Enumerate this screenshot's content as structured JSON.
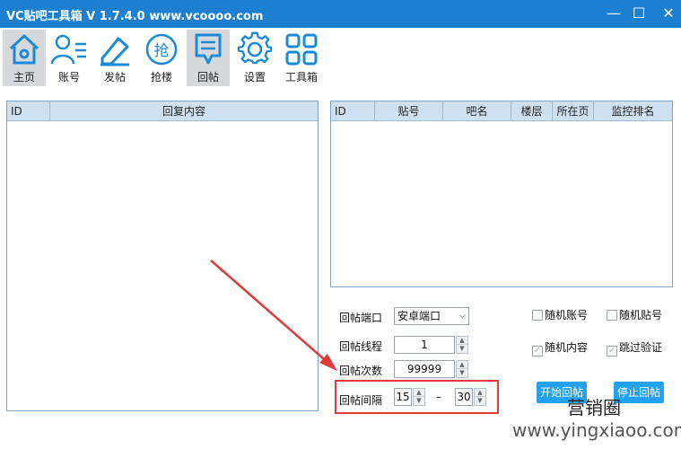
{
  "window": {
    "title": "VC贴吧工具箱 V 1.7.4.0   www.vcoooo.com",
    "minimize": "—",
    "maximize": "☐",
    "close": "✕"
  },
  "toolbar": {
    "items": [
      {
        "label": "主页",
        "icon": "home-icon"
      },
      {
        "label": "账号",
        "icon": "user-list-icon"
      },
      {
        "label": "发帖",
        "icon": "pen-icon"
      },
      {
        "label": "抢楼",
        "icon": "grab-icon",
        "glyph": "抢"
      },
      {
        "label": "回帖",
        "icon": "reply-doc-icon"
      },
      {
        "label": "设置",
        "icon": "gear-icon"
      },
      {
        "label": "工具箱",
        "icon": "grid-icon"
      }
    ],
    "active": "回帖"
  },
  "left_table": {
    "headers": [
      "ID",
      "回复内容"
    ]
  },
  "right_table": {
    "headers": [
      "ID",
      "贴号",
      "吧名",
      "楼层",
      "所在页",
      "监控排名"
    ]
  },
  "form": {
    "port_label": "回帖端口",
    "port_value": "安卓端口",
    "threads_label": "回帖线程",
    "threads_value": "1",
    "count_label": "回帖次数",
    "count_value": "99999",
    "interval_label": "回帖间隔",
    "interval_min": "15",
    "interval_sep": "–",
    "interval_max": "30",
    "random_account": "随机账号",
    "random_post": "随机贴号",
    "random_content": "随机内容",
    "skip_verify": "跳过验证",
    "start_button": "开始回帖",
    "stop_button": "停止回帖"
  },
  "watermark": {
    "brand": "营销圈",
    "site": "www.yingxiaoo.com"
  },
  "colors": {
    "titlebar": "#1d7fcf",
    "accent": "#23a1f2",
    "highlight_box": "#e03a3a",
    "icon_blue": "#1a8ad8"
  }
}
